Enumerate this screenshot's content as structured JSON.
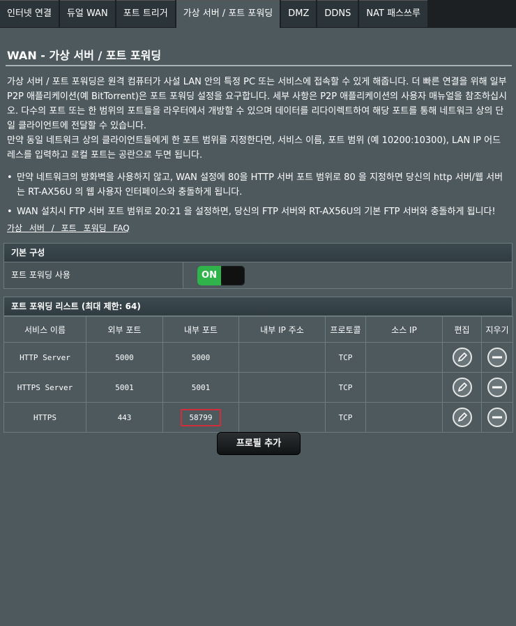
{
  "tabs": [
    "인터넷 연결",
    "듀얼 WAN",
    "포트 트리거",
    "가상 서버 / 포트 포워딩",
    "DMZ",
    "DDNS",
    "NAT 패스쓰루"
  ],
  "page_title": "WAN - 가상 서버 / 포트 포워딩",
  "description": [
    "가상 서버 / 포트 포워딩은 원격 컴퓨터가 사설 LAN 안의 특정 PC 또는 서비스에 접속할 수 있게 해줍니다. 더 빠른 연결을 위해 일부 P2P 애플리케이션(예 BitTorrent)은 포트 포워딩 설정을 요구합니다. 세부 사항은 P2P 애플리케이션의 사용자 매뉴얼을 참조하십시오. 다수의 포트 또는 한 범위의 포트들을 라우터에서 개방할 수 있으며 데이터를 리다이렉트하여 해당 포트를 통해 네트워크 상의 단일 클라이언트에 전달할 수 있습니다.",
    "만약 동일 네트워크 상의 클라이언트들에게 한 포트 범위를 지정한다면, 서비스 이름, 포트 범위 (예 10200:10300), LAN IP 어드레스를 입력하고 로컬 포트는 공란으로 두면 됩니다."
  ],
  "bullets": [
    "만약 네트워크의 방화벽을 사용하지 않고, WAN 설정에 80을 HTTP 서버 포트 범위로 80 을 지정하면 당신의 http 서버/웹 서버는 RT-AX56U 의 웹 사용자 인터페이스와 충돌하게 됩니다.",
    "WAN 설치시 FTP 서버 포트 범위로 20:21 을 설정하면, 당신의 FTP 서버와 RT-AX56U의 기본 FTP 서버와 충돌하게 됩니다!"
  ],
  "faq_link": "가상 서버 / 포트 포워딩 FAQ",
  "basic": {
    "header": "기본 구성",
    "enable_label": "포트 포워딩 사용",
    "toggle_on": "ON"
  },
  "list": {
    "header": "포트 포워딩 리스트 (최대 제한: 64)",
    "columns": [
      "서비스 이름",
      "외부 포트",
      "내부 포트",
      "내부 IP 주소",
      "프로토콜",
      "소스 IP",
      "편집",
      "지우기"
    ],
    "rows": [
      {
        "name": "HTTP Server",
        "ext": "5000",
        "int": "5000",
        "ip": "",
        "proto": "TCP",
        "src": ""
      },
      {
        "name": "HTTPS Server",
        "ext": "5001",
        "int": "5001",
        "ip": "",
        "proto": "TCP",
        "src": ""
      },
      {
        "name": "HTTPS",
        "ext": "443",
        "int": "58799",
        "ip": "",
        "proto": "TCP",
        "src": ""
      }
    ]
  },
  "add_profile_label": "프로필 추가",
  "colors": {
    "toggle_on": "#2fb34a",
    "highlight": "#d02d3a",
    "background": "#4d595d"
  }
}
